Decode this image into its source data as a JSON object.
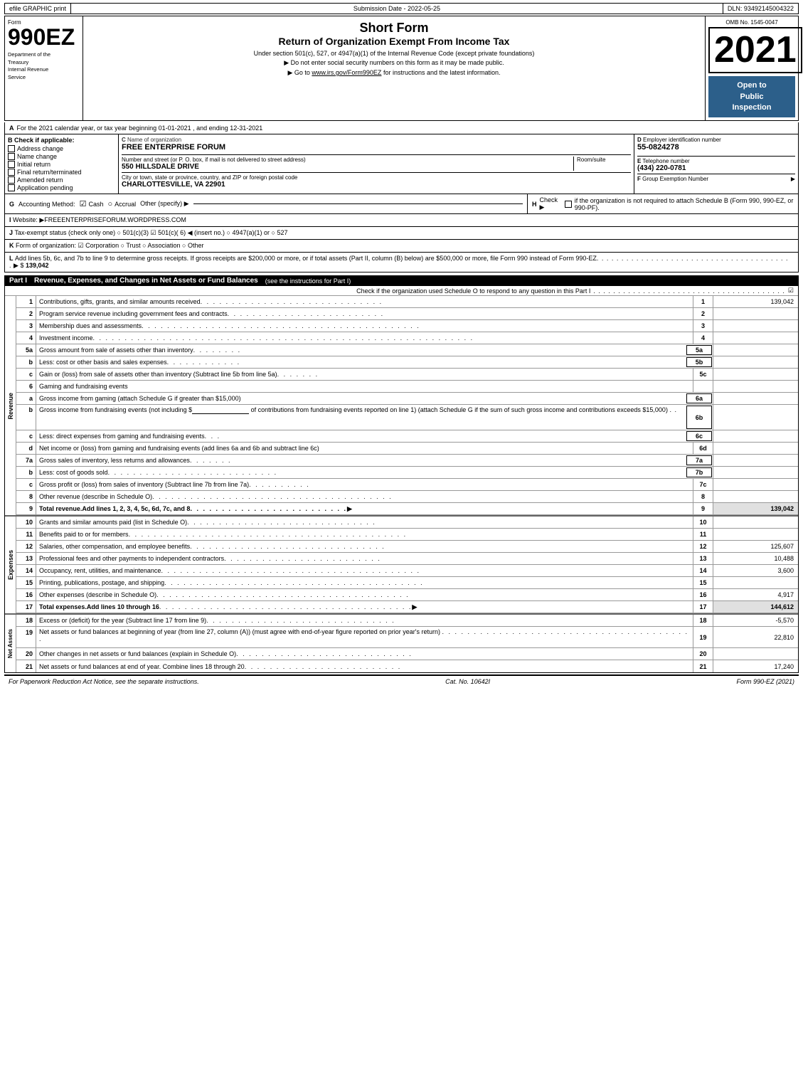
{
  "topbar": {
    "efile": "efile GRAPHIC print",
    "submission_label": "Submission Date - 2022-05-25",
    "dln_label": "DLN: 93492145004322"
  },
  "header": {
    "omb": "OMB No. 1545-0047",
    "form_number": "990EZ",
    "form_label": "Form",
    "dept_line1": "Department of the",
    "dept_line2": "Treasury",
    "dept_line3": "Internal Revenue",
    "dept_line4": "Service",
    "title_main": "Short Form",
    "title_sub": "Return of Organization Exempt From Income Tax",
    "desc1": "Under section 501(c), 527, or 4947(a)(1) of the Internal Revenue Code (except private foundations)",
    "desc2": "▶ Do not enter social security numbers on this form as it may be made public.",
    "desc3": "▶ Go to ",
    "desc3_link": "www.irs.gov/Form990EZ",
    "desc3_end": " for instructions and the latest information.",
    "year": "2021",
    "open_to_public_line1": "Open to",
    "open_to_public_line2": "Public",
    "open_to_public_line3": "Inspection"
  },
  "section_a": {
    "a_label": "A",
    "a_text": "For the 2021 calendar year, or tax year beginning 01-01-2021 , and ending 12-31-2021",
    "b_label": "B",
    "b_title": "Check if applicable:",
    "b_items": [
      {
        "label": "Address change",
        "checked": false
      },
      {
        "label": "Name change",
        "checked": false
      },
      {
        "label": "Initial return",
        "checked": false
      },
      {
        "label": "Final return/terminated",
        "checked": false
      },
      {
        "label": "Amended return",
        "checked": false
      },
      {
        "label": "Application pending",
        "checked": false
      }
    ],
    "c_label": "C",
    "c_title": "Name of organization",
    "c_value": "FREE ENTERPRISE FORUM",
    "addr_label": "Number and street (or P. O. box, if mail is not delivered to street address)",
    "addr_value": "550 HILLSDALE DRIVE",
    "room_label": "Room/suite",
    "room_value": "",
    "city_label": "City or town, state or province, country, and ZIP or foreign postal code",
    "city_value": "CHARLOTTESVILLE, VA  22901",
    "d_label": "D",
    "d_title": "Employer identification number",
    "d_value": "55-0824278",
    "e_label": "E",
    "e_title": "Telephone number",
    "e_value": "(434) 220-0781",
    "f_label": "F",
    "f_title": "Group Exemption Number",
    "f_arrow": "▶"
  },
  "section_g": {
    "g_label": "G",
    "g_text": "Accounting Method:",
    "g_cash_checked": true,
    "g_cash": "Cash",
    "g_accrual": "Accrual",
    "g_other": "Other (specify) ▶",
    "h_label": "H",
    "h_text": "Check ▶",
    "h_circle": "○",
    "h_desc": "if the organization is not required to attach Schedule B (Form 990, 990-EZ, or 990-PF)."
  },
  "section_i": {
    "i_label": "I",
    "i_text": "Website: ▶FREEENTERPRISEFORUM.WORDPRESS.COM"
  },
  "section_j": {
    "j_label": "J",
    "j_text": "Tax-exempt status (check only one) ○ 501(c)(3) ☑ 501(c)( 6) ◀ (insert no.) ○ 4947(a)(1) or ○ 527"
  },
  "section_k": {
    "k_label": "K",
    "k_text": "Form of organization: ☑ Corporation  ○ Trust  ○ Association  ○ Other"
  },
  "section_l": {
    "l_label": "L",
    "l_text": "Add lines 5b, 6c, and 7b to line 9 to determine gross receipts. If gross receipts are $200,000 or more, or if total assets (Part II, column (B) below) are $500,000 or more, file Form 990 instead of Form 990-EZ",
    "l_dots": ". . . . . . . . . . . . . . . . . . . . . . . . . . . . . . . . . . . . . . . .",
    "l_arrow": "▶ $",
    "l_value": "139,042"
  },
  "part1": {
    "label": "Part I",
    "title": "Revenue, Expenses, and Changes in Net Assets or Fund Balances",
    "title_note": "(see the instructions for Part I)",
    "check_text": "Check if the organization used Schedule O to respond to any question in this Part I",
    "check_dots": ". . . . . . . . . . . . . . . . . . . . . . . . . . . . . . . . . . . . . . .",
    "check_box": "☑",
    "lines": [
      {
        "num": "1",
        "desc": "Contributions, gifts, grants, and similar amounts received",
        "dots": ". . . . . . . . . . . . . . . . . . . . . . . . . . . . .",
        "line_num": "1",
        "value": "139,042"
      },
      {
        "num": "2",
        "desc": "Program service revenue including government fees and contracts",
        "dots": ". . . . . . . . . . . . . . . . . . . . . . . .",
        "line_num": "2",
        "value": ""
      },
      {
        "num": "3",
        "desc": "Membership dues and assessments",
        "dots": ". . . . . . . . . . . . . . . . . . . . . . . . . . . . . . . . . . . . . . . . . . . .",
        "line_num": "3",
        "value": ""
      },
      {
        "num": "4",
        "desc": "Investment income",
        "dots": ". . . . . . . . . . . . . . . . . . . . . . . . . . . . . . . . . . . . . . . . . . . . . . . . . . . . . . . . . . . .",
        "line_num": "4",
        "value": ""
      },
      {
        "num": "5a",
        "desc": "Gross amount from sale of assets other than inventory",
        "dots": ". . . . . . . .",
        "ref": "5a",
        "line_num": "",
        "value": ""
      },
      {
        "num": "5b",
        "desc": "Less: cost or other basis and sales expenses",
        "dots": ". . . . . . . . . . . .",
        "ref": "5b",
        "line_num": "",
        "value": ""
      },
      {
        "num": "5c",
        "desc": "Gain or (loss) from sale of assets other than inventory (Subtract line 5b from line 5a)",
        "dots": ". . . . . . .",
        "line_num": "5c",
        "value": ""
      },
      {
        "num": "6",
        "desc": "Gaming and fundraising events",
        "dots": "",
        "line_num": "",
        "value": ""
      },
      {
        "num": "6a",
        "sublabel": "a",
        "desc": "Gross income from gaming (attach Schedule G if greater than $15,000)",
        "dots": "",
        "ref": "6a",
        "line_num": "",
        "value": ""
      },
      {
        "num": "6b",
        "sublabel": "b",
        "desc": "Gross income from fundraising events (not including $",
        "desc2": " of contributions from fundraising events reported on line 1) (attach Schedule G if the sum of such gross income and contributions exceeds $15,000)",
        "dots": ". .",
        "ref": "6b",
        "line_num": "",
        "value": ""
      },
      {
        "num": "6c",
        "sublabel": "c",
        "desc": "Less: direct expenses from gaming and fundraising events",
        "dots": ". . .",
        "ref": "6c",
        "line_num": "",
        "value": ""
      },
      {
        "num": "6d",
        "sublabel": "d",
        "desc": "Net income or (loss) from gaming and fundraising events (add lines 6a and 6b and subtract line 6c)",
        "dots": "",
        "line_num": "6d",
        "value": ""
      },
      {
        "num": "7a",
        "sublabel": "a",
        "desc": "Gross sales of inventory, less returns and allowances",
        "dots": ". . . . . . .",
        "ref": "7a",
        "line_num": "",
        "value": ""
      },
      {
        "num": "7b",
        "sublabel": "b",
        "desc": "Less: cost of goods sold",
        "dots": ". . . . . . . . . . . . . . . . . . . . . . . . . . .",
        "ref": "7b",
        "line_num": "",
        "value": ""
      },
      {
        "num": "7c",
        "sublabel": "c",
        "desc": "Gross profit or (loss) from sales of inventory (Subtract line 7b from line 7a)",
        "dots": ". . . . . . . . . .",
        "line_num": "7c",
        "value": ""
      },
      {
        "num": "8",
        "desc": "Other revenue (describe in Schedule O)",
        "dots": ". . . . . . . . . . . . . . . . . . . . . . . . . . . . . . . . . . . . . .",
        "line_num": "8",
        "value": ""
      },
      {
        "num": "9",
        "desc": "Total revenue. Add lines 1, 2, 3, 4, 5c, 6d, 7c, and 8",
        "dots": ". . . . . . . . . . . . . . . . . . . . . . . . . .",
        "arrow": "▶",
        "line_num": "9",
        "value": "139,042",
        "bold": true
      }
    ]
  },
  "part1_expenses": {
    "lines": [
      {
        "num": "10",
        "desc": "Grants and similar amounts paid (list in Schedule O)",
        "dots": ". . . . . . . . . . . . . . . . . . . . . . . . . . . . . .",
        "line_num": "10",
        "value": ""
      },
      {
        "num": "11",
        "desc": "Benefits paid to or for members",
        "dots": ". . . . . . . . . . . . . . . . . . . . . . . . . . . . . . . . . . . . . . . . . . . .",
        "line_num": "11",
        "value": ""
      },
      {
        "num": "12",
        "desc": "Salaries, other compensation, and employee benefits",
        "dots": ". . . . . . . . . . . . . . . . . . . . . . . . . . . . . . . .",
        "line_num": "12",
        "value": "125,607"
      },
      {
        "num": "13",
        "desc": "Professional fees and other payments to independent contractors",
        "dots": ". . . . . . . . . . . . . . . . . . . . . . . . . .",
        "line_num": "13",
        "value": "10,488"
      },
      {
        "num": "14",
        "desc": "Occupancy, rent, utilities, and maintenance",
        "dots": ". . . . . . . . . . . . . . . . . . . . . . . . . . . . . . . . . . . . . . . . .",
        "line_num": "14",
        "value": "3,600"
      },
      {
        "num": "15",
        "desc": "Printing, publications, postage, and shipping",
        "dots": ". . . . . . . . . . . . . . . . . . . . . . . . . . . . . . . . . . . . . . . . .",
        "line_num": "15",
        "value": ""
      },
      {
        "num": "16",
        "desc": "Other expenses (describe in Schedule O)",
        "dots": ". . . . . . . . . . . . . . . . . . . . . . . . . . . . . . . . . . . . . . . .",
        "line_num": "16",
        "value": "4,917"
      },
      {
        "num": "17",
        "desc": "Total expenses. Add lines 10 through 16",
        "dots": ". . . . . . . . . . . . . . . . . . . . . . . . . . . . . . . . . . . . . . . .",
        "arrow": "▶",
        "line_num": "17",
        "value": "144,612",
        "bold": true
      }
    ]
  },
  "part1_assets": {
    "lines": [
      {
        "num": "18",
        "desc": "Excess or (deficit) for the year (Subtract line 17 from line 9)",
        "dots": ". . . . . . . . . . . . . . . . . . . . . . . . . . . . . .",
        "line_num": "18",
        "value": "-5,570"
      },
      {
        "num": "19",
        "desc": "Net assets or fund balances at beginning of year (from line 27, column (A)) (must agree with end-of-year figure reported on prior year's return)",
        "dots": ". . . . . . . . . . . . . . . . . . . . . . . . . . . . . . . . . . . . . . . .",
        "line_num": "19",
        "value": "22,810"
      },
      {
        "num": "20",
        "desc": "Other changes in net assets or fund balances (explain in Schedule O)",
        "dots": ". . . . . . . . . . . . . . . . . . . . . . . . . . . .",
        "line_num": "20",
        "value": ""
      },
      {
        "num": "21",
        "desc": "Net assets or fund balances at end of year. Combine lines 18 through 20",
        "dots": ". . . . . . . . . . . . . . . . . . . . . . . . . .",
        "line_num": "21",
        "value": "17,240"
      }
    ]
  },
  "footer": {
    "left": "For Paperwork Reduction Act Notice, see the separate instructions.",
    "center": "Cat. No. 10642I",
    "right": "Form 990-EZ (2021)"
  }
}
